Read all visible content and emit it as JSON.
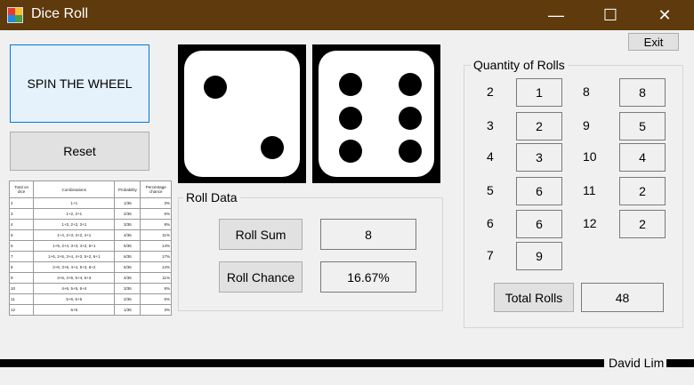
{
  "window": {
    "title": "Dice Roll",
    "minimize": "—",
    "maximize": "☐",
    "close": "✕"
  },
  "buttons": {
    "spin": "SPIN THE WHEEL",
    "reset": "Reset",
    "exit": "Exit"
  },
  "dice": [
    {
      "value": 2
    },
    {
      "value": 6
    }
  ],
  "roll_data": {
    "title": "Roll Data",
    "sum_label": "Roll Sum",
    "sum_value": "8",
    "chance_label": "Roll Chance",
    "chance_value": "16.67%"
  },
  "quantity": {
    "title": "Quantity of Rolls",
    "rows_left": [
      {
        "label": "2",
        "value": "1"
      },
      {
        "label": "3",
        "value": "2"
      },
      {
        "label": "4",
        "value": "3"
      },
      {
        "label": "5",
        "value": "6"
      },
      {
        "label": "6",
        "value": "6"
      },
      {
        "label": "7",
        "value": "9"
      }
    ],
    "rows_right": [
      {
        "label": "8",
        "value": "8"
      },
      {
        "label": "9",
        "value": "5"
      },
      {
        "label": "10",
        "value": "4"
      },
      {
        "label": "11",
        "value": "2"
      },
      {
        "label": "12",
        "value": "2"
      }
    ],
    "total_label": "Total Rolls",
    "total_value": "48"
  },
  "probability_table": {
    "headers": [
      "Total on dice",
      "Combinations",
      "Probability",
      "Percentage chance"
    ],
    "rows": [
      [
        "2",
        "1+1",
        "1/36",
        "3%"
      ],
      [
        "3",
        "1+2, 2+1",
        "2/36",
        "6%"
      ],
      [
        "4",
        "1+3, 2+2, 3+1",
        "3/36",
        "8%"
      ],
      [
        "5",
        "1+4, 2+3, 3+2, 4+1",
        "4/36",
        "11%"
      ],
      [
        "6",
        "1+5, 2+4, 3+3, 4+2, 5+1",
        "5/36",
        "14%"
      ],
      [
        "7",
        "1+6, 2+5, 3+4, 4+3, 5+2, 6+1",
        "6/36",
        "17%"
      ],
      [
        "8",
        "2+6, 3+5, 4+4, 5+3, 6+2",
        "5/36",
        "14%"
      ],
      [
        "9",
        "3+6, 4+5, 5+4, 6+3",
        "4/36",
        "11%"
      ],
      [
        "10",
        "4+6, 5+5, 6+4",
        "3/36",
        "8%"
      ],
      [
        "11",
        "5+6, 6+5",
        "2/36",
        "6%"
      ],
      [
        "12",
        "6+6",
        "1/36",
        "3%"
      ]
    ]
  },
  "footer": {
    "author": "David Lim"
  }
}
